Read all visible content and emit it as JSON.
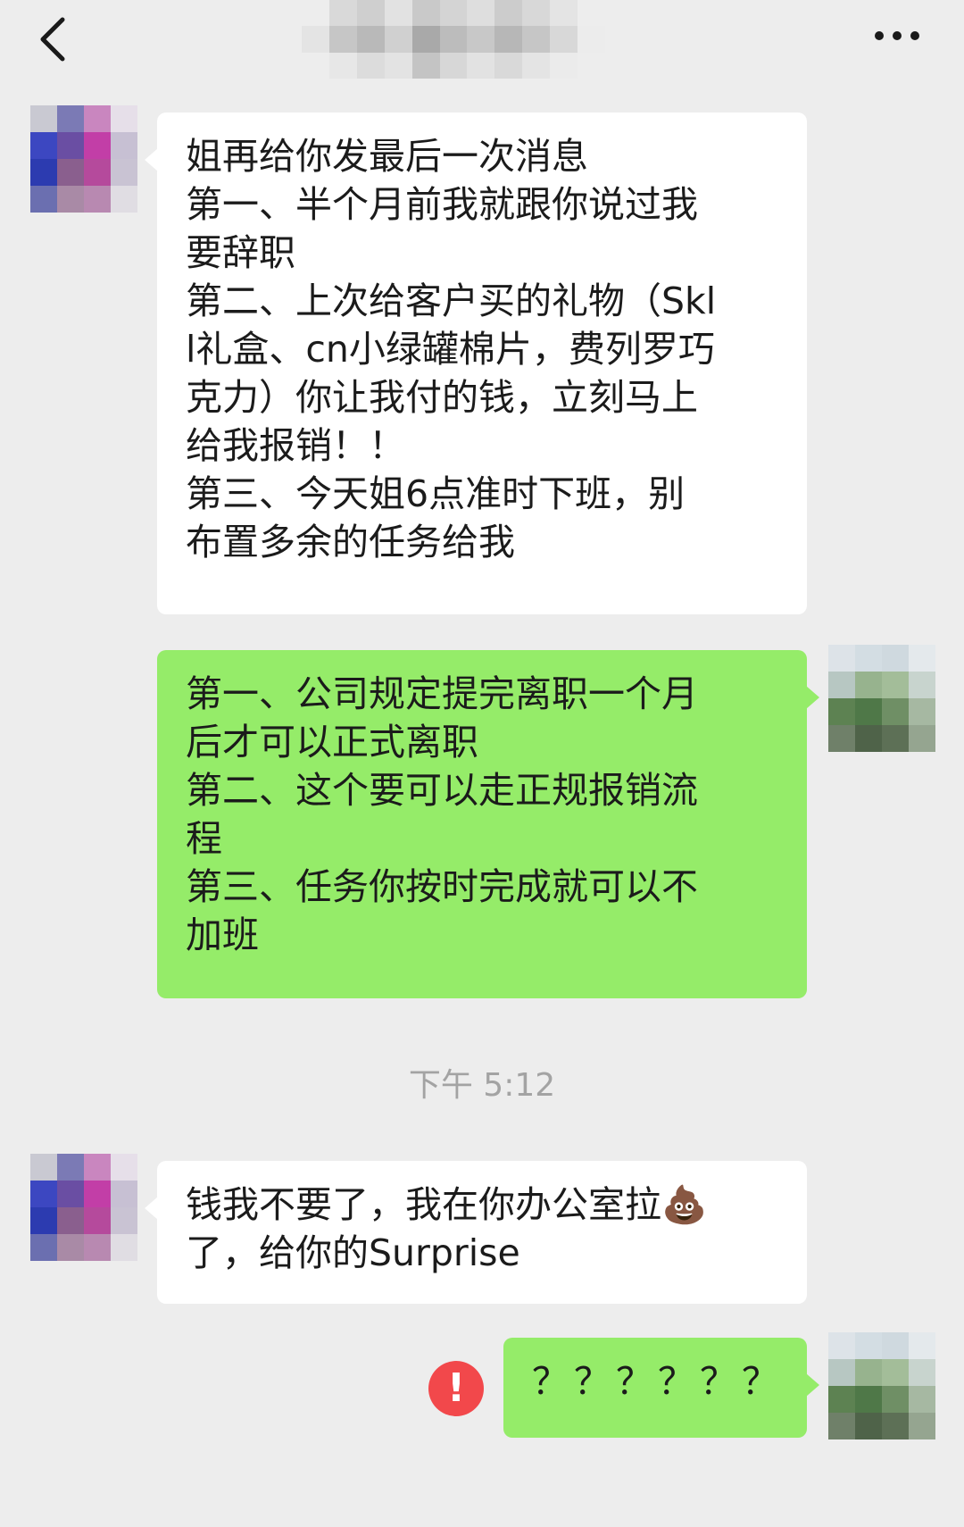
{
  "header": {
    "back_icon": "chevron-left-icon",
    "more_icon": "more-dots-icon"
  },
  "messages": [
    {
      "side": "left",
      "lines": [
        "姐再给你发最后一次消息",
        "第一、半个月前我就跟你说过我",
        "要辞职",
        "第二、上次给客户买的礼物（Skl",
        "l礼盒、cn小绿罐棉片，费列罗巧",
        "克力）你让我付的钱，立刻马上",
        "给我报销！！",
        "第三、今天姐6点准时下班，别",
        "布置多余的任务给我"
      ]
    },
    {
      "side": "right",
      "lines": [
        "第一、公司规定提完离职一个月",
        "后才可以正式离职",
        "第二、这个要可以走正规报销流",
        "程",
        "第三、任务你按时完成就可以不",
        "加班"
      ]
    },
    {
      "side": "left",
      "lines": [
        "钱我不要了，我在你办公室拉💩",
        "了，给你的Surprise"
      ]
    },
    {
      "side": "right",
      "lines": [
        "？？？？？？"
      ],
      "status_icon": "error-icon",
      "status_text": "!"
    }
  ],
  "timestamp": "下午 5:12",
  "colors": {
    "background": "#ededed",
    "bubble_incoming": "#ffffff",
    "bubble_outgoing": "#95ec69",
    "error": "#f2484b",
    "timestamp_text": "#a3a3a3"
  }
}
